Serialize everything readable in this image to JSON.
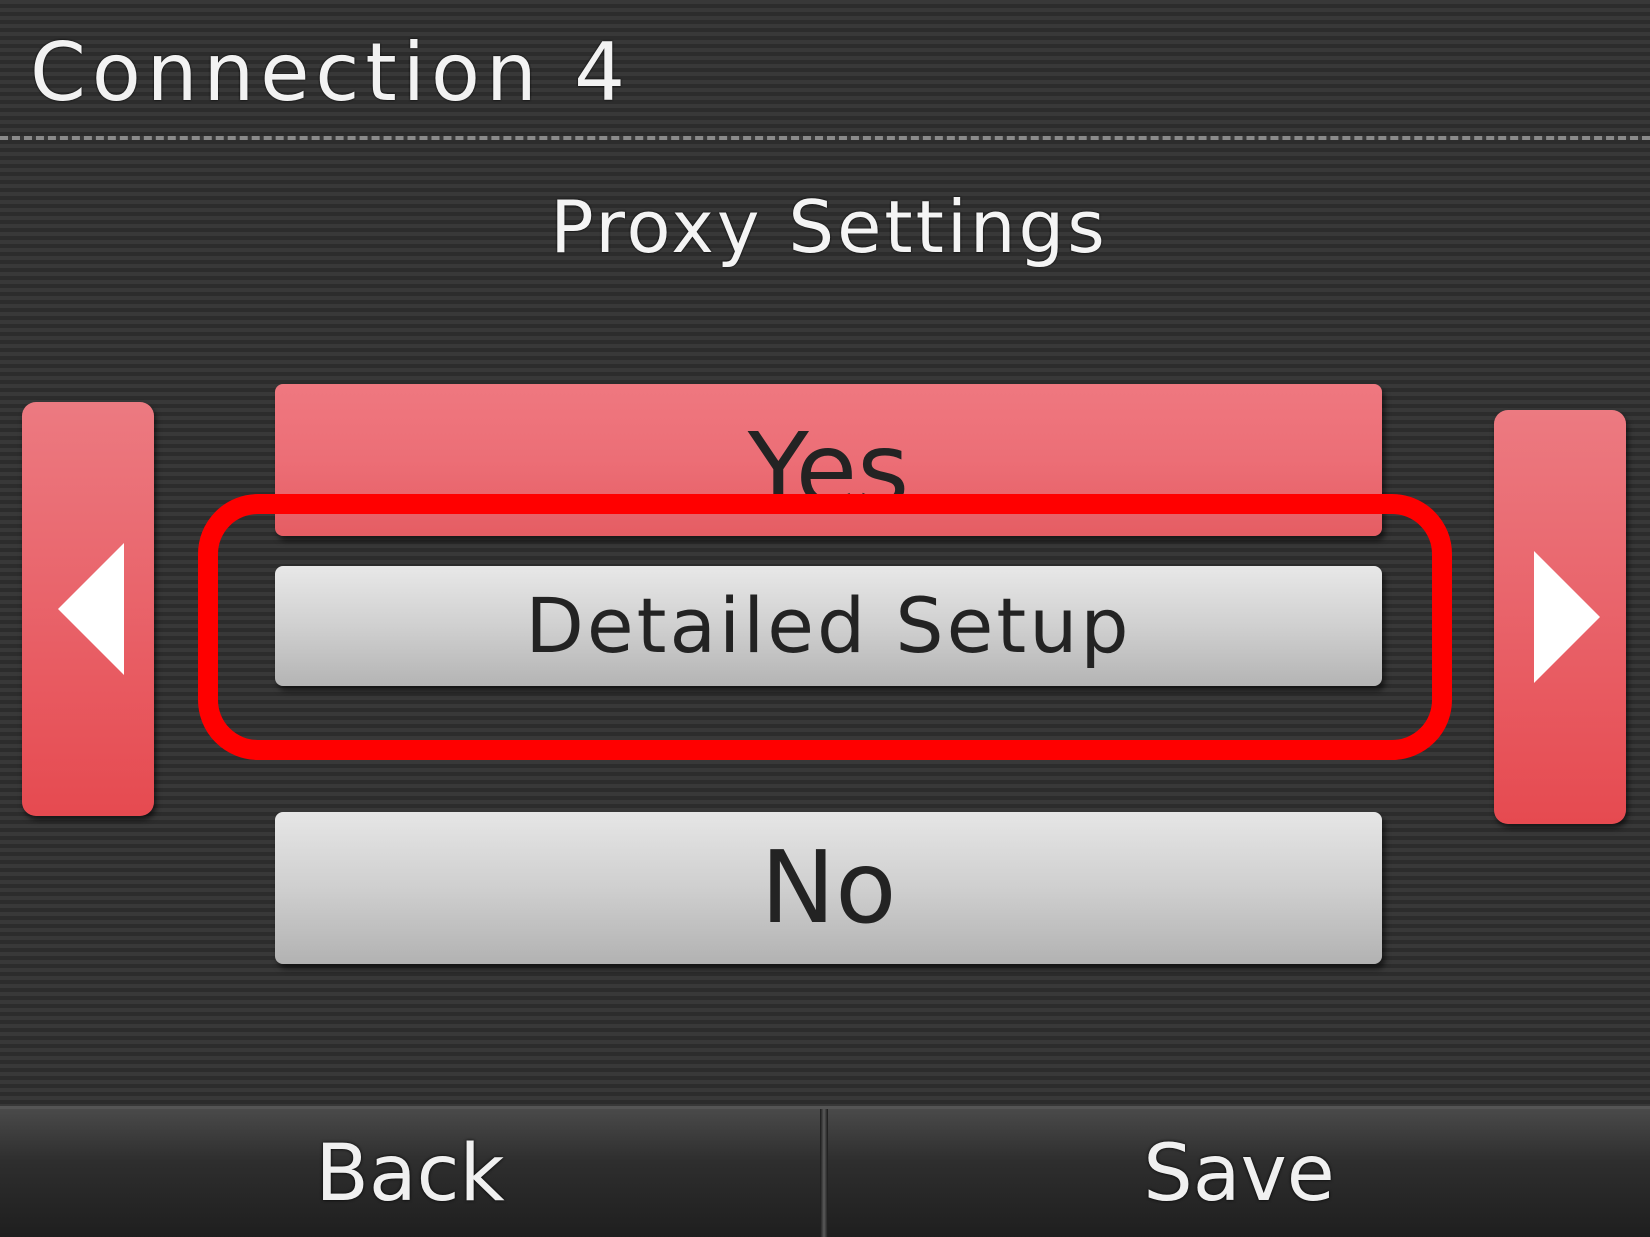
{
  "header": {
    "title": "Connection 4"
  },
  "screen": {
    "subtitle": "Proxy Settings"
  },
  "navigation": {
    "left_icon": "triangle-left-icon",
    "right_icon": "triangle-right-icon"
  },
  "options": [
    {
      "label": "Yes",
      "selected": true
    },
    {
      "label": "Detailed Setup",
      "selected": false
    },
    {
      "label": "No",
      "selected": false
    }
  ],
  "footer": {
    "back_label": "Back",
    "save_label": "Save"
  },
  "colors": {
    "accent_red": "#e9656c",
    "highlight": "#ff0000",
    "background": "#323232",
    "button_gray": "#cfcfcf"
  }
}
